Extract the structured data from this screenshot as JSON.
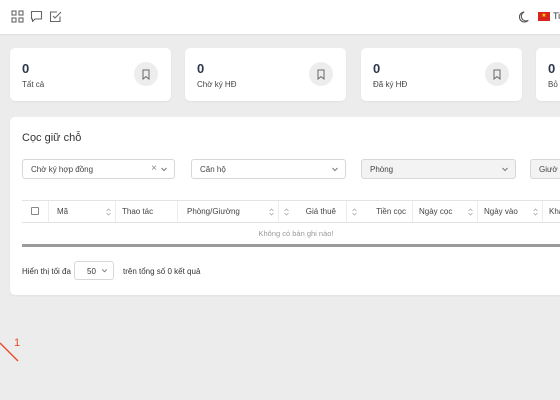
{
  "topbar": {
    "icons": [
      "grid-icon",
      "chat-icon",
      "checklist-icon"
    ],
    "theme_icon": "moon-icon",
    "flag_icon": "vietnam-flag-icon",
    "flag_star": "★",
    "language": "Ti"
  },
  "stats": [
    {
      "value": "0",
      "label": "Tất cả"
    },
    {
      "value": "0",
      "label": "Chờ ký HĐ"
    },
    {
      "value": "0",
      "label": "Đã ký HĐ"
    },
    {
      "value": "0",
      "label": "Bỏ"
    }
  ],
  "panel": {
    "title": "Cọc giữ chỗ",
    "filters": [
      {
        "label": "Chờ ký hợp đồng",
        "clearable": true
      },
      {
        "label": "Căn hộ"
      },
      {
        "label": "Phòng"
      },
      {
        "label": "Giườ"
      }
    ],
    "table": {
      "columns": [
        "Mã",
        "Thao tác",
        "Phòng/Giường",
        "Giá thuê",
        "Tiền cọc",
        "Ngày cọc",
        "Ngày vào",
        "Khách"
      ],
      "empty_text": "Không có bản ghi nào!"
    },
    "pagination": {
      "prefix": "Hiển thị tối đa",
      "page_size": "50",
      "suffix": "trên tổng số 0 kết quả"
    }
  },
  "annotation": {
    "number": "1",
    "color": "#e84a2a"
  },
  "colors": {
    "background": "#ececec",
    "card": "#ffffff",
    "accent_text": "#2d3748"
  }
}
